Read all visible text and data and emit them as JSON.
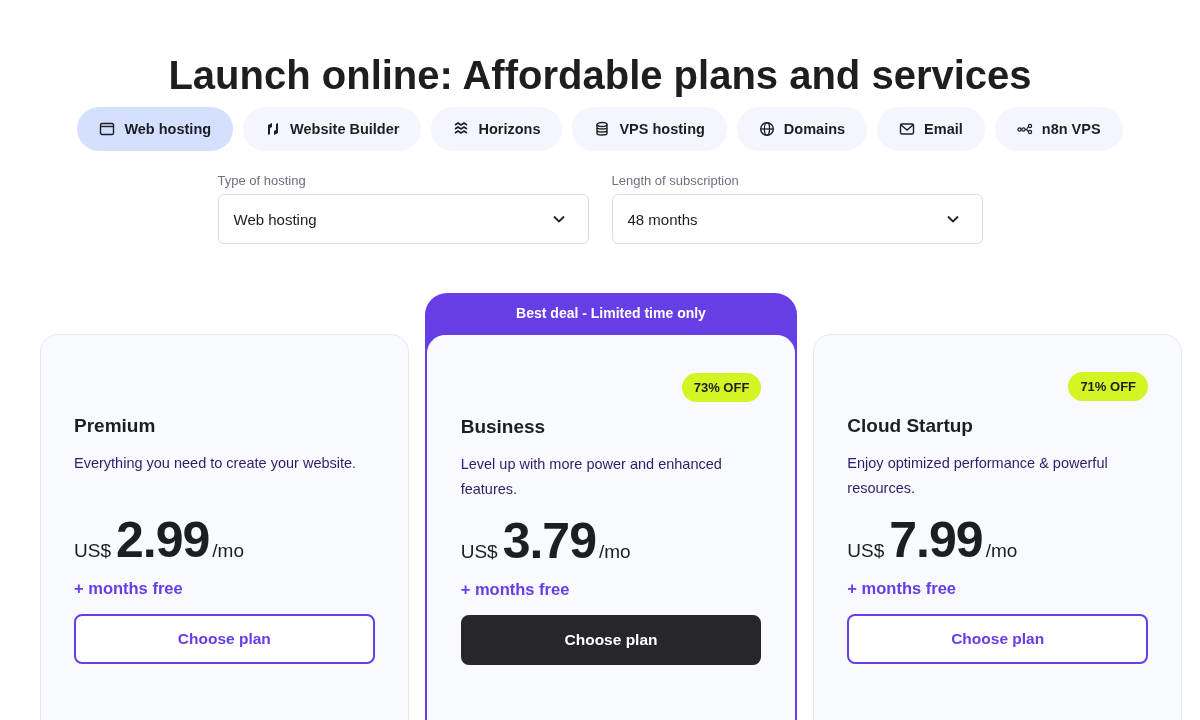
{
  "title": "Launch online: Affordable plans and services",
  "tabs": [
    {
      "label": "Web hosting",
      "selected": true
    },
    {
      "label": "Website Builder",
      "selected": false
    },
    {
      "label": "Horizons",
      "selected": false
    },
    {
      "label": "VPS hosting",
      "selected": false
    },
    {
      "label": "Domains",
      "selected": false
    },
    {
      "label": "Email",
      "selected": false
    },
    {
      "label": "n8n VPS",
      "selected": false
    }
  ],
  "filters": [
    {
      "label": "Type of hosting",
      "value": "Web hosting"
    },
    {
      "label": "Length of subscription",
      "value": "48 months"
    }
  ],
  "plans": [
    {
      "name": "Premium",
      "description": "Everything you need to create your website.",
      "currency": "US$",
      "price": "2.99",
      "period": "/mo",
      "bonus": "+ months free",
      "button": "Choose plan",
      "featured": false
    },
    {
      "name": "Business",
      "description": "Level up with more power and enhanced features.",
      "currency": "US$",
      "price": "3.79",
      "period": "/mo",
      "bonus": "+ months free",
      "button": "Choose plan",
      "featured": true,
      "banner": "Best deal - Limited time only",
      "badge": "73% OFF"
    },
    {
      "name": "Cloud Startup",
      "description": "Enjoy optimized performance & powerful resources.",
      "currency": "US$",
      "price": "7.99",
      "period": "/mo",
      "bonus": "+ months free",
      "button": "Choose plan",
      "featured": false,
      "badge": "71% OFF"
    }
  ]
}
